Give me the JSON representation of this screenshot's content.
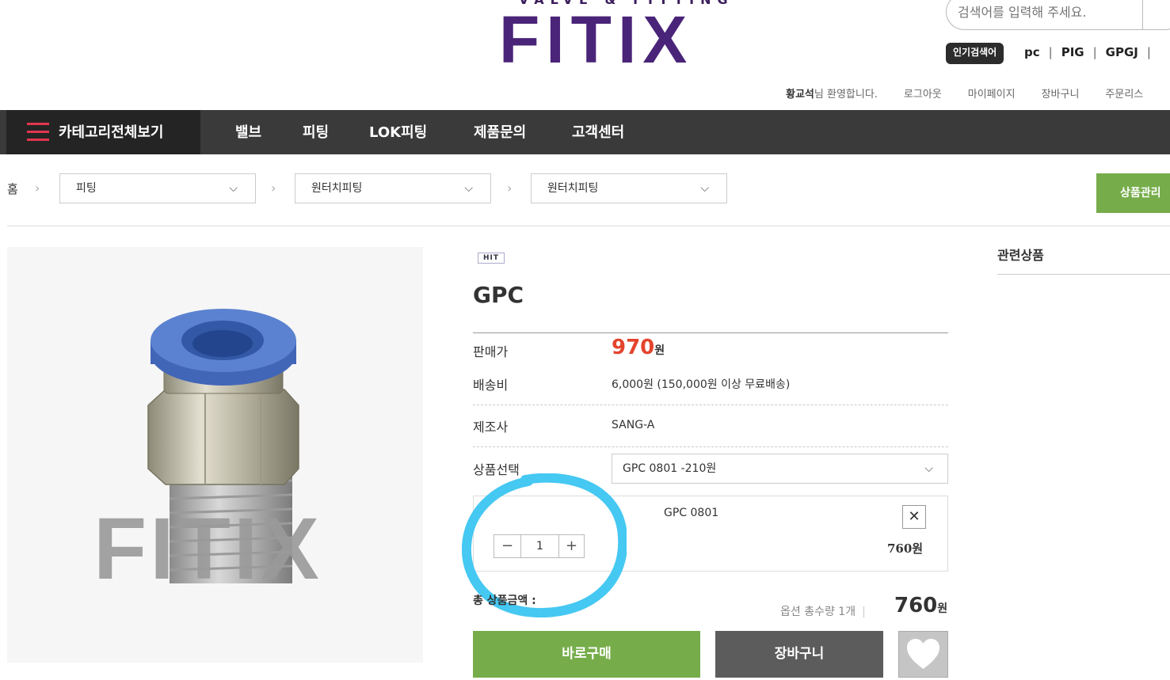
{
  "header": {
    "logo_subtitle": "VALVE & FITTING",
    "logo": "FITIX",
    "search_placeholder": "검색어를 입력해 주세요.",
    "popular_label": "인기검색어",
    "popular_terms": [
      "pc",
      "PIG",
      "GPGJ"
    ],
    "user_name": "황교석",
    "welcome_suffix": "님 환영합니다.",
    "links": [
      "로그아웃",
      "마이페이지",
      "장바구니",
      "주문리스"
    ]
  },
  "nav": {
    "category_all": "카테고리전체보기",
    "items": [
      "밸브",
      "피팅",
      "LOK피팅",
      "제품문의",
      "고객센터"
    ]
  },
  "breadcrumb": {
    "home": "홈",
    "levels": [
      "피팅",
      "원터치피팅",
      "원터치피팅"
    ],
    "manage_button": "상품관리"
  },
  "product": {
    "badge": "HIT",
    "name": "GPC",
    "image_watermark": "FITIX",
    "price_label": "판매가",
    "price": "970",
    "price_unit": "원",
    "shipping_label": "배송비",
    "shipping_value": "6,000원 (150,000원 이상 무료배송)",
    "maker_label": "제조사",
    "maker_value": "SANG-A",
    "option_label": "상품선택",
    "option_selected": "GPC 0801 -210원"
  },
  "selected_option": {
    "name": "GPC 0801",
    "remove": "✕",
    "quantity": "1",
    "minus": "−",
    "plus": "+",
    "price": "760원"
  },
  "total": {
    "label": "총 상품금액 :",
    "quantity_text": "옵션 총수량 1개",
    "amount": "760",
    "unit": "원"
  },
  "buttons": {
    "buy_now": "바로구매",
    "cart": "장바구니"
  },
  "related": {
    "title": "관련상품"
  },
  "colors": {
    "brand": "#4a2479",
    "accent_green": "#76ad4a",
    "price_red": "#e4442d",
    "annotation_ring": "#45c8f2"
  }
}
